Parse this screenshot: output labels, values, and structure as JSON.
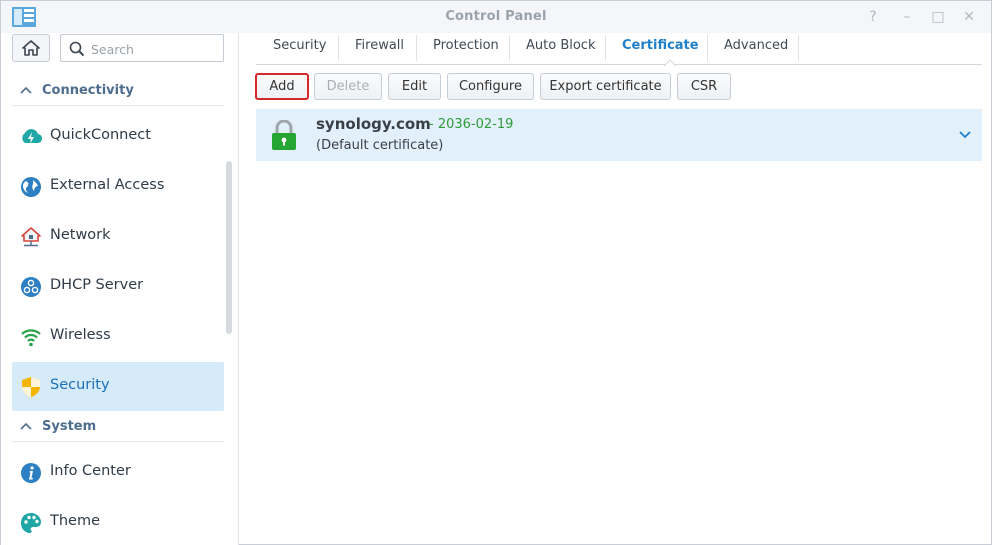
{
  "window": {
    "title": "Control Panel",
    "controls": [
      "?",
      "–",
      "□",
      "✕"
    ]
  },
  "sidebar": {
    "search_placeholder": "Search",
    "sections": [
      {
        "label": "Connectivity"
      },
      {
        "label": "System"
      }
    ],
    "items": [
      {
        "label": "QuickConnect",
        "icon": "quickconnect-icon"
      },
      {
        "label": "External Access",
        "icon": "globe-icon"
      },
      {
        "label": "Network",
        "icon": "network-house-icon"
      },
      {
        "label": "DHCP Server",
        "icon": "dhcp-icon"
      },
      {
        "label": "Wireless",
        "icon": "wifi-icon"
      },
      {
        "label": "Security",
        "icon": "shield-icon",
        "selected": true
      },
      {
        "label": "Info Center",
        "icon": "info-icon"
      },
      {
        "label": "Theme",
        "icon": "palette-icon"
      }
    ]
  },
  "tabs": [
    {
      "label": "Security"
    },
    {
      "label": "Firewall"
    },
    {
      "label": "Protection"
    },
    {
      "label": "Auto Block"
    },
    {
      "label": "Certificate",
      "active": true
    },
    {
      "label": "Advanced"
    }
  ],
  "toolbar": {
    "add": "Add",
    "delete": "Delete",
    "edit": "Edit",
    "configure": "Configure",
    "export": "Export certificate",
    "csr": "CSR"
  },
  "certificates": [
    {
      "name": "synology.com",
      "date": "- 2036-02-19",
      "subtitle": "(Default certificate)"
    }
  ],
  "colors": {
    "accent": "#1f7fc9",
    "selected_bg": "#d6ebf9",
    "cert_row_bg": "#e1f0fb",
    "date_green": "#2f9a3a",
    "highlight_red": "#d4282b"
  }
}
